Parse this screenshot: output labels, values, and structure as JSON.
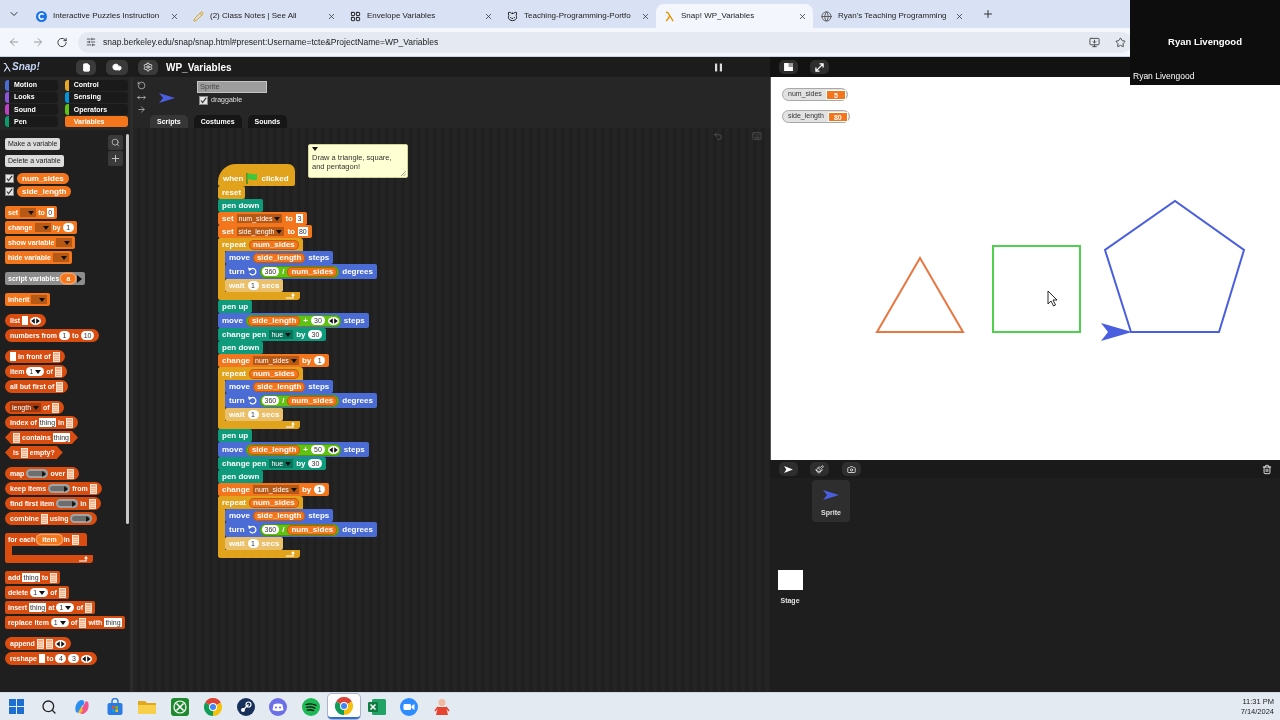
{
  "browser": {
    "tabs": [
      {
        "kind": "letter_circle",
        "title": "Interactive Puzzles Instruction",
        "selected": false
      },
      {
        "kind": "pencil",
        "title": "(2) Class Notes | See All",
        "selected": false
      },
      {
        "kind": "grid",
        "title": "Envelope Variables",
        "selected": false
      },
      {
        "kind": "cat",
        "title": "Teaching-Programming-Portfo",
        "selected": false
      },
      {
        "kind": "lambda",
        "title": "Snap! WP_Variables",
        "selected": true
      },
      {
        "kind": "globe",
        "title": "Ryan's Teaching Programming",
        "selected": false
      }
    ],
    "url": "snap.berkeley.edu/snap/snap.html#present:Username=tcte&ProjectName=WP_Variables"
  },
  "video_overlay": {
    "name": "Ryan Livengood",
    "caption": "Ryan Livengood"
  },
  "snap": {
    "logo": "Snap!",
    "project_title": "WP_Variables",
    "categories": [
      {
        "label": "Motion",
        "color": "#4a6cd4",
        "selected": false
      },
      {
        "label": "Looks",
        "color": "#8a55d7",
        "selected": false
      },
      {
        "label": "Sound",
        "color": "#bb42c3",
        "selected": false
      },
      {
        "label": "Pen",
        "color": "#0e9a6c",
        "selected": false
      },
      {
        "label": "Control",
        "color": "#e6a822",
        "selected": false
      },
      {
        "label": "Sensing",
        "color": "#0494dc",
        "selected": false
      },
      {
        "label": "Operators",
        "color": "#62c213",
        "selected": false
      },
      {
        "label": "Variables",
        "color": "#f3761d",
        "selected": true
      }
    ],
    "palette": {
      "buttons": [
        "Make a variable",
        "Delete a variable"
      ],
      "variables": [
        {
          "name": "num_sides",
          "checked": true
        },
        {
          "name": "side_length",
          "checked": true
        }
      ],
      "groups": [
        [
          {
            "kind": "command",
            "color": "#f3761d",
            "parts": [
              {
                "kind": "label",
                "text": "set"
              },
              {
                "kind": "menu"
              },
              {
                "kind": "label",
                "text": "to"
              },
              {
                "kind": "text",
                "text": "0"
              }
            ]
          },
          {
            "kind": "command",
            "color": "#f3761d",
            "parts": [
              {
                "kind": "label",
                "text": "change"
              },
              {
                "kind": "menu"
              },
              {
                "kind": "label",
                "text": "by"
              },
              {
                "kind": "num",
                "text": "1"
              }
            ]
          },
          {
            "kind": "command",
            "color": "#f3761d",
            "parts": [
              {
                "kind": "label",
                "text": "show variable"
              },
              {
                "kind": "menu"
              }
            ]
          },
          {
            "kind": "command",
            "color": "#f3761d",
            "parts": [
              {
                "kind": "label",
                "text": "hide variable"
              },
              {
                "kind": "menu"
              }
            ]
          }
        ],
        [
          {
            "kind": "command",
            "color": "#8d8d8d",
            "parts": [
              {
                "kind": "label",
                "text": "script variables"
              },
              {
                "kind": "upvar",
                "text": "a"
              },
              {
                "kind": "right_arrow"
              }
            ]
          }
        ],
        [
          {
            "kind": "command",
            "color": "#f3761d",
            "parts": [
              {
                "kind": "label",
                "text": "inherit"
              },
              {
                "kind": "menu"
              }
            ]
          }
        ],
        [
          {
            "kind": "reporter",
            "color": "#d94d11",
            "parts": [
              {
                "kind": "label",
                "text": "list"
              },
              {
                "kind": "blank"
              },
              {
                "kind": "arrows"
              }
            ]
          },
          {
            "kind": "reporter",
            "color": "#d94d11",
            "parts": [
              {
                "kind": "label",
                "text": "numbers from"
              },
              {
                "kind": "num",
                "text": "1"
              },
              {
                "kind": "label",
                "text": "to"
              },
              {
                "kind": "num",
                "text": "10"
              }
            ]
          }
        ],
        [
          {
            "kind": "reporter",
            "color": "#d94d11",
            "parts": [
              {
                "kind": "blank"
              },
              {
                "kind": "label",
                "text": "in front of"
              },
              {
                "kind": "list"
              }
            ]
          },
          {
            "kind": "reporter",
            "color": "#d94d11",
            "parts": [
              {
                "kind": "label",
                "text": "item"
              },
              {
                "kind": "num_menu",
                "text": "1"
              },
              {
                "kind": "label",
                "text": "of"
              },
              {
                "kind": "list"
              }
            ]
          },
          {
            "kind": "reporter",
            "color": "#d94d11",
            "parts": [
              {
                "kind": "label",
                "text": "all but first of"
              },
              {
                "kind": "list"
              }
            ]
          }
        ],
        [
          {
            "kind": "reporter",
            "color": "#d94d11",
            "parts": [
              {
                "kind": "menu",
                "text": "length"
              },
              {
                "kind": "label",
                "text": "of"
              },
              {
                "kind": "list"
              }
            ]
          },
          {
            "kind": "reporter",
            "color": "#d94d11",
            "parts": [
              {
                "kind": "label",
                "text": "index of"
              },
              {
                "kind": "text",
                "text": "thing"
              },
              {
                "kind": "label",
                "text": "in"
              },
              {
                "kind": "list"
              }
            ]
          },
          {
            "kind": "predicate",
            "color": "#d94d11",
            "parts": [
              {
                "kind": "list"
              },
              {
                "kind": "label",
                "text": "contains"
              },
              {
                "kind": "text",
                "text": "thing"
              }
            ]
          },
          {
            "kind": "predicate",
            "color": "#d94d11",
            "parts": [
              {
                "kind": "label",
                "text": "is"
              },
              {
                "kind": "list"
              },
              {
                "kind": "label",
                "text": "empty?"
              }
            ]
          }
        ],
        [
          {
            "kind": "reporter",
            "color": "#d94d11",
            "parts": [
              {
                "kind": "label",
                "text": "map"
              },
              {
                "kind": "ring"
              },
              {
                "kind": "label",
                "text": "over"
              },
              {
                "kind": "list"
              }
            ]
          },
          {
            "kind": "reporter",
            "color": "#d94d11",
            "parts": [
              {
                "kind": "label",
                "text": "keep items"
              },
              {
                "kind": "ring"
              },
              {
                "kind": "label",
                "text": "from"
              },
              {
                "kind": "list"
              }
            ]
          },
          {
            "kind": "reporter",
            "color": "#d94d11",
            "parts": [
              {
                "kind": "label",
                "text": "find first item"
              },
              {
                "kind": "ring"
              },
              {
                "kind": "label",
                "text": "in"
              },
              {
                "kind": "list"
              }
            ]
          },
          {
            "kind": "reporter",
            "color": "#d94d11",
            "parts": [
              {
                "kind": "label",
                "text": "combine"
              },
              {
                "kind": "list"
              },
              {
                "kind": "label",
                "text": "using"
              },
              {
                "kind": "ring"
              }
            ]
          }
        ],
        [
          {
            "kind": "c",
            "color": "#d94d11",
            "parts": [
              {
                "kind": "label",
                "text": "for each"
              },
              {
                "kind": "upvar",
                "text": "item"
              },
              {
                "kind": "label",
                "text": "in"
              },
              {
                "kind": "list"
              }
            ]
          }
        ],
        [
          {
            "kind": "command",
            "color": "#d94d11",
            "parts": [
              {
                "kind": "label",
                "text": "add"
              },
              {
                "kind": "text",
                "text": "thing"
              },
              {
                "kind": "label",
                "text": "to"
              },
              {
                "kind": "list"
              }
            ]
          },
          {
            "kind": "command",
            "color": "#d94d11",
            "parts": [
              {
                "kind": "label",
                "text": "delete"
              },
              {
                "kind": "num_menu",
                "text": "1"
              },
              {
                "kind": "label",
                "text": "of"
              },
              {
                "kind": "list"
              }
            ]
          },
          {
            "kind": "command",
            "color": "#d94d11",
            "parts": [
              {
                "kind": "label",
                "text": "insert"
              },
              {
                "kind": "text",
                "text": "thing"
              },
              {
                "kind": "label",
                "text": "at"
              },
              {
                "kind": "num_menu",
                "text": "1"
              },
              {
                "kind": "label",
                "text": "of"
              },
              {
                "kind": "list"
              }
            ]
          },
          {
            "kind": "command",
            "color": "#d94d11",
            "parts": [
              {
                "kind": "label",
                "text": "replace item"
              },
              {
                "kind": "num_menu",
                "text": "1"
              },
              {
                "kind": "label",
                "text": "of"
              },
              {
                "kind": "list"
              },
              {
                "kind": "label",
                "text": "with"
              },
              {
                "kind": "text",
                "text": "thing"
              }
            ]
          }
        ],
        [
          {
            "kind": "reporter",
            "color": "#d94d11",
            "parts": [
              {
                "kind": "label",
                "text": "append"
              },
              {
                "kind": "list"
              },
              {
                "kind": "list"
              },
              {
                "kind": "arrows"
              }
            ]
          },
          {
            "kind": "reporter",
            "color": "#d94d11",
            "parts": [
              {
                "kind": "label",
                "text": "reshape"
              },
              {
                "kind": "blank"
              },
              {
                "kind": "label",
                "text": "to"
              },
              {
                "kind": "num",
                "text": "4"
              },
              {
                "kind": "num",
                "text": "3"
              },
              {
                "kind": "arrows"
              }
            ]
          }
        ]
      ]
    },
    "sprite": {
      "name": "Sprite",
      "draggable": {
        "label": "draggable",
        "checked": true
      },
      "tabs": [
        {
          "label": "Scripts",
          "selected": true
        },
        {
          "label": "Costumes",
          "selected": false
        },
        {
          "label": "Sounds",
          "selected": false
        }
      ]
    },
    "comment": {
      "text": "Draw a triangle, square, and pentagon!"
    },
    "script": [
      {
        "kind": "hat",
        "color": "#e1a21c",
        "parts": [
          {
            "kind": "label",
            "text": "when"
          },
          {
            "kind": "flag"
          },
          {
            "kind": "label",
            "text": "clicked"
          }
        ]
      },
      {
        "kind": "command",
        "color": "#e1a21c",
        "parts": [
          {
            "kind": "label",
            "text": "reset"
          }
        ]
      },
      {
        "kind": "command",
        "color": "#0f9b7b",
        "parts": [
          {
            "kind": "label",
            "text": "pen down"
          }
        ]
      },
      {
        "kind": "command",
        "color": "#f3761d",
        "parts": [
          {
            "kind": "label",
            "text": "set"
          },
          {
            "kind": "menu",
            "text": "num_sides"
          },
          {
            "kind": "label",
            "text": "to"
          },
          {
            "kind": "text",
            "text": "3"
          }
        ]
      },
      {
        "kind": "command",
        "color": "#f3761d",
        "parts": [
          {
            "kind": "label",
            "text": "set"
          },
          {
            "kind": "menu",
            "text": "side_length"
          },
          {
            "kind": "label",
            "text": "to"
          },
          {
            "kind": "text",
            "text": "80"
          }
        ]
      },
      {
        "kind": "c",
        "color": "#e1a21c",
        "parts": [
          {
            "kind": "label",
            "text": "repeat"
          },
          {
            "kind": "var",
            "text": "num_sides"
          }
        ],
        "children": [
          {
            "kind": "command",
            "color": "#4a6cd4",
            "parts": [
              {
                "kind": "label",
                "text": "move"
              },
              {
                "kind": "var",
                "text": "side_length"
              },
              {
                "kind": "label",
                "text": "steps"
              }
            ]
          },
          {
            "kind": "command",
            "color": "#4a6cd4",
            "parts": [
              {
                "kind": "label",
                "text": "turn"
              },
              {
                "kind": "turn_left"
              },
              {
                "kind": "op",
                "color": "#62c213",
                "parts": [
                  {
                    "kind": "num",
                    "text": "360"
                  },
                  {
                    "kind": "label",
                    "text": "/"
                  },
                  {
                    "kind": "var",
                    "text": "num_sides"
                  }
                ]
              },
              {
                "kind": "label",
                "text": "degrees"
              }
            ]
          },
          {
            "kind": "command",
            "color": "#ebc06a",
            "parts": [
              {
                "kind": "label",
                "text": "wait"
              },
              {
                "kind": "num",
                "text": "1"
              },
              {
                "kind": "label",
                "text": "secs"
              }
            ]
          }
        ]
      },
      {
        "kind": "command",
        "color": "#0f9b7b",
        "parts": [
          {
            "kind": "label",
            "text": "pen up"
          }
        ]
      },
      {
        "kind": "command",
        "color": "#4a6cd4",
        "parts": [
          {
            "kind": "label",
            "text": "move"
          },
          {
            "kind": "op",
            "color": "#62c213",
            "parts": [
              {
                "kind": "var",
                "text": "side_length"
              },
              {
                "kind": "label",
                "text": "+"
              },
              {
                "kind": "num",
                "text": "30"
              },
              {
                "kind": "arrows"
              }
            ]
          },
          {
            "kind": "label",
            "text": "steps"
          }
        ]
      },
      {
        "kind": "command",
        "color": "#0f9b7b",
        "parts": [
          {
            "kind": "label",
            "text": "change pen"
          },
          {
            "kind": "menu",
            "text": "hue"
          },
          {
            "kind": "label",
            "text": "by"
          },
          {
            "kind": "num",
            "text": "30"
          }
        ]
      },
      {
        "kind": "command",
        "color": "#0f9b7b",
        "parts": [
          {
            "kind": "label",
            "text": "pen down"
          }
        ]
      },
      {
        "kind": "command",
        "color": "#f3761d",
        "parts": [
          {
            "kind": "label",
            "text": "change"
          },
          {
            "kind": "menu",
            "text": "num_sides"
          },
          {
            "kind": "label",
            "text": "by"
          },
          {
            "kind": "num",
            "text": "1"
          }
        ]
      },
      {
        "kind": "c",
        "color": "#e1a21c",
        "parts": [
          {
            "kind": "label",
            "text": "repeat"
          },
          {
            "kind": "var",
            "text": "num_sides"
          }
        ],
        "children": [
          {
            "kind": "command",
            "color": "#4a6cd4",
            "parts": [
              {
                "kind": "label",
                "text": "move"
              },
              {
                "kind": "var",
                "text": "side_length"
              },
              {
                "kind": "label",
                "text": "steps"
              }
            ]
          },
          {
            "kind": "command",
            "color": "#4a6cd4",
            "parts": [
              {
                "kind": "label",
                "text": "turn"
              },
              {
                "kind": "turn_left"
              },
              {
                "kind": "op",
                "color": "#62c213",
                "parts": [
                  {
                    "kind": "num",
                    "text": "360"
                  },
                  {
                    "kind": "label",
                    "text": "/"
                  },
                  {
                    "kind": "var",
                    "text": "num_sides"
                  }
                ]
              },
              {
                "kind": "label",
                "text": "degrees"
              }
            ]
          },
          {
            "kind": "command",
            "color": "#ebc06a",
            "parts": [
              {
                "kind": "label",
                "text": "wait"
              },
              {
                "kind": "num",
                "text": "1"
              },
              {
                "kind": "label",
                "text": "secs"
              }
            ]
          }
        ]
      },
      {
        "kind": "command",
        "color": "#0f9b7b",
        "parts": [
          {
            "kind": "label",
            "text": "pen up"
          }
        ]
      },
      {
        "kind": "command",
        "color": "#4a6cd4",
        "parts": [
          {
            "kind": "label",
            "text": "move"
          },
          {
            "kind": "op",
            "color": "#62c213",
            "parts": [
              {
                "kind": "var",
                "text": "side_length"
              },
              {
                "kind": "label",
                "text": "+"
              },
              {
                "kind": "num",
                "text": "50"
              },
              {
                "kind": "arrows"
              }
            ]
          },
          {
            "kind": "label",
            "text": "steps"
          }
        ]
      },
      {
        "kind": "command",
        "color": "#0f9b7b",
        "parts": [
          {
            "kind": "label",
            "text": "change pen"
          },
          {
            "kind": "menu",
            "text": "hue"
          },
          {
            "kind": "label",
            "text": "by"
          },
          {
            "kind": "num",
            "text": "30"
          }
        ]
      },
      {
        "kind": "command",
        "color": "#0f9b7b",
        "parts": [
          {
            "kind": "label",
            "text": "pen down"
          }
        ]
      },
      {
        "kind": "command",
        "color": "#f3761d",
        "parts": [
          {
            "kind": "label",
            "text": "change"
          },
          {
            "kind": "menu",
            "text": "num_sides"
          },
          {
            "kind": "label",
            "text": "by"
          },
          {
            "kind": "num",
            "text": "1"
          }
        ]
      },
      {
        "kind": "c",
        "color": "#e1a21c",
        "parts": [
          {
            "kind": "label",
            "text": "repeat"
          },
          {
            "kind": "var",
            "text": "num_sides"
          }
        ],
        "children": [
          {
            "kind": "command",
            "color": "#4a6cd4",
            "parts": [
              {
                "kind": "label",
                "text": "move"
              },
              {
                "kind": "var",
                "text": "side_length"
              },
              {
                "kind": "label",
                "text": "steps"
              }
            ]
          },
          {
            "kind": "command",
            "color": "#4a6cd4",
            "parts": [
              {
                "kind": "label",
                "text": "turn"
              },
              {
                "kind": "turn_left"
              },
              {
                "kind": "op",
                "color": "#62c213",
                "parts": [
                  {
                    "kind": "num",
                    "text": "360"
                  },
                  {
                    "kind": "label",
                    "text": "/"
                  },
                  {
                    "kind": "var",
                    "text": "num_sides"
                  }
                ]
              },
              {
                "kind": "label",
                "text": "degrees"
              }
            ]
          },
          {
            "kind": "command",
            "color": "#ebc06a",
            "parts": [
              {
                "kind": "label",
                "text": "wait"
              },
              {
                "kind": "num",
                "text": "1"
              },
              {
                "kind": "label",
                "text": "secs"
              }
            ]
          }
        ]
      }
    ],
    "stage": {
      "watchers": [
        {
          "name": "num_sides",
          "value": "5"
        },
        {
          "name": "side_length",
          "value": "80"
        }
      ]
    },
    "corral": {
      "sprites": [
        {
          "name": "Sprite",
          "selected": true
        }
      ],
      "stage_label": "Stage"
    }
  },
  "taskbar": {
    "apps": [
      {
        "kind": "start",
        "selected": false
      },
      {
        "kind": "search",
        "selected": false
      },
      {
        "kind": "swirl",
        "selected": false
      },
      {
        "kind": "bag",
        "selected": false
      },
      {
        "kind": "folder",
        "selected": false
      },
      {
        "kind": "xtile",
        "selected": false
      },
      {
        "kind": "wheel",
        "selected": false
      },
      {
        "kind": "disc",
        "selected": false
      },
      {
        "kind": "chat",
        "selected": false
      },
      {
        "kind": "waves",
        "selected": false
      },
      {
        "kind": "wheel",
        "selected": true
      },
      {
        "kind": "sheet",
        "selected": false
      },
      {
        "kind": "video",
        "selected": false
      },
      {
        "kind": "figure",
        "selected": false
      }
    ],
    "time": "11:31 PM",
    "date": "7/14/2024"
  }
}
